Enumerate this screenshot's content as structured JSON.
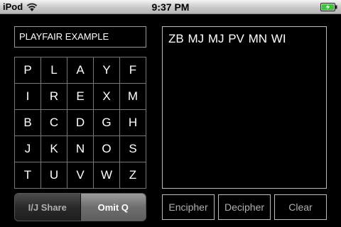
{
  "status_bar": {
    "carrier": "iPod",
    "time": "9:37 PM",
    "wifi_icon": "wifi-icon",
    "battery_icon": "battery-charging-icon"
  },
  "key_phrase": "PLAYFAIR EXAMPLE",
  "grid": [
    [
      "P",
      "L",
      "A",
      "Y",
      "F"
    ],
    [
      "I",
      "R",
      "E",
      "X",
      "M"
    ],
    [
      "B",
      "C",
      "D",
      "G",
      "H"
    ],
    [
      "J",
      "K",
      "N",
      "O",
      "S"
    ],
    [
      "T",
      "U",
      "V",
      "W",
      "Z"
    ]
  ],
  "mode": {
    "options": [
      "I/J Share",
      "Omit Q"
    ],
    "selected": "Omit Q"
  },
  "output_text": "ZB MJ MJ PV MN WI",
  "actions": {
    "encipher": "Encipher",
    "decipher": "Decipher",
    "clear": "Clear"
  },
  "colors": {
    "background": "#000000",
    "border": "#bdbdbd",
    "battery_green": "#3cc43c"
  }
}
